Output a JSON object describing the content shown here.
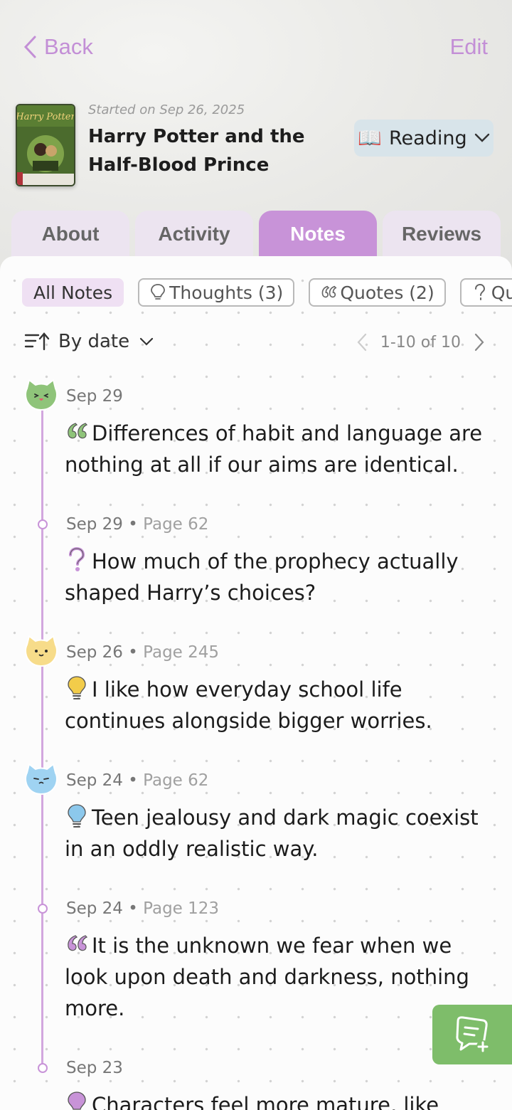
{
  "nav": {
    "back_label": "Back",
    "edit_label": "Edit"
  },
  "book": {
    "started": "Started on Sep 26, 2025",
    "title": "Harry Potter and the Half-Blood Prince",
    "cover_text": "Harry Potter",
    "status_emoji": "📖",
    "status_label": "Reading"
  },
  "tabs": [
    {
      "label": "About"
    },
    {
      "label": "Activity"
    },
    {
      "label": "Notes",
      "active": true
    },
    {
      "label": "Reviews"
    }
  ],
  "filters": [
    {
      "label": "All Notes",
      "icon": "none"
    },
    {
      "label": "Thoughts (3)",
      "icon": "lightbulb-icon"
    },
    {
      "label": "Quotes (2)",
      "icon": "quote-icon"
    },
    {
      "label": "Qu",
      "icon": "question-icon"
    }
  ],
  "sort": {
    "label": "By date"
  },
  "pagination": {
    "text": "1-10 of 10"
  },
  "entries": [
    {
      "date": "Sep 29",
      "page": "",
      "icon": "quote-icon",
      "icon_color": "#8fc47a",
      "avatar": "green-cat-avatar",
      "avatar_color": "#8fc47a",
      "text": "Differences of habit and language are nothing at all if our aims are identical."
    },
    {
      "date": "Sep 29",
      "page": "Page 62",
      "icon": "question-icon",
      "icon_color": "#c893d8",
      "avatar": "none",
      "text": "How much of the prophecy actually shaped Harry’s choices?"
    },
    {
      "date": "Sep 26",
      "page": "Page 245",
      "icon": "lightbulb-icon",
      "icon_color": "#f2cc4a",
      "avatar": "yellow-cat-avatar",
      "avatar_color": "#f7dc8a",
      "text": "I like how everyday school life continues alongside bigger worries."
    },
    {
      "date": "Sep 24",
      "page": "Page 62",
      "icon": "lightbulb-icon",
      "icon_color": "#8cc8ec",
      "avatar": "blue-cat-avatar",
      "avatar_color": "#9fd3f2",
      "text": "Teen jealousy and dark magic coexist in an oddly realistic way."
    },
    {
      "date": "Sep 24",
      "page": "Page 123",
      "icon": "quote-icon",
      "icon_color": "#c893d8",
      "avatar": "none",
      "text": "It is the unknown we fear when we look upon death and darkness, nothing more."
    },
    {
      "date": "Sep 23",
      "page": "",
      "icon": "lightbulb-icon",
      "icon_color": "#c893d8",
      "avatar": "none",
      "text": "Characters feel more mature, like they"
    }
  ],
  "colors": {
    "accent": "#c893d8",
    "fab": "#7ebd6a",
    "status_bg": "#d8e4ea"
  }
}
